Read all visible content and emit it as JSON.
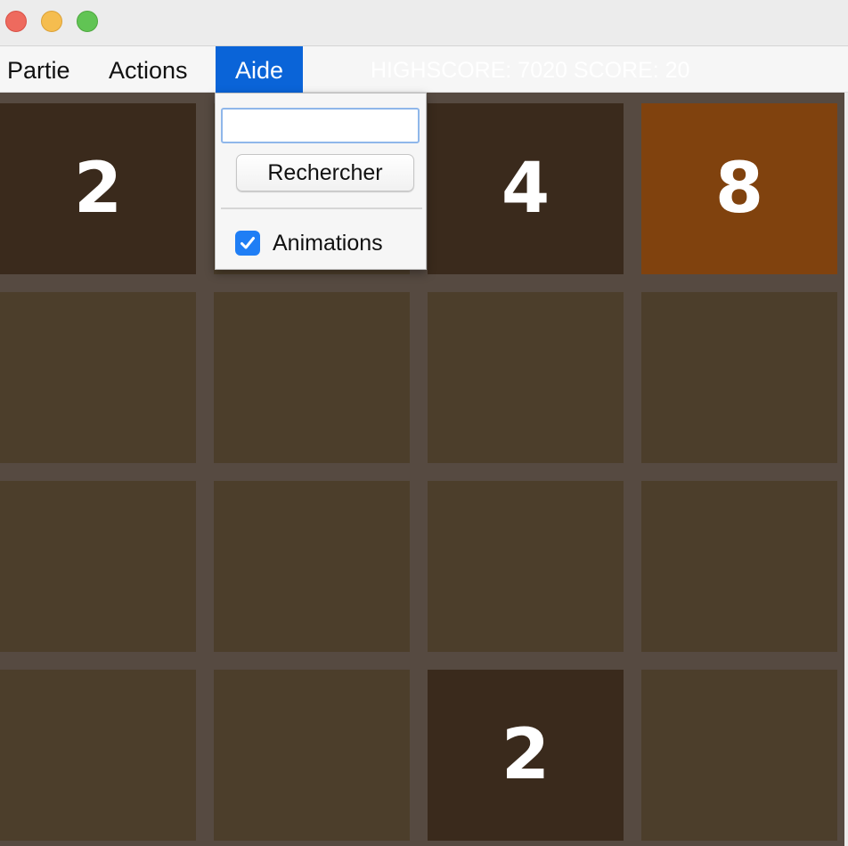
{
  "menubar": {
    "items": [
      {
        "label": "Partie"
      },
      {
        "label": "Actions"
      },
      {
        "label": "Aide"
      }
    ],
    "score_text": "HIGHSCORE: 7020 SCORE: 20"
  },
  "dropdown": {
    "search_value": "",
    "search_button_label": "Rechercher",
    "animations_label": "Animations",
    "animations_checked": true
  },
  "board": {
    "rows": [
      [
        "2",
        "",
        "4",
        "8"
      ],
      [
        "",
        "",
        "",
        ""
      ],
      [
        "",
        "",
        "",
        ""
      ],
      [
        "",
        "",
        "2",
        ""
      ]
    ]
  },
  "colors": {
    "board_background": "#564a41",
    "empty_tile": "#4c3e2b",
    "tile_2": "#3a2a1c",
    "tile_4": "#3a2a1c",
    "tile_8": "#80420e",
    "menu_highlight": "#0a64d8",
    "checkbox_accent": "#1f7ef5"
  }
}
